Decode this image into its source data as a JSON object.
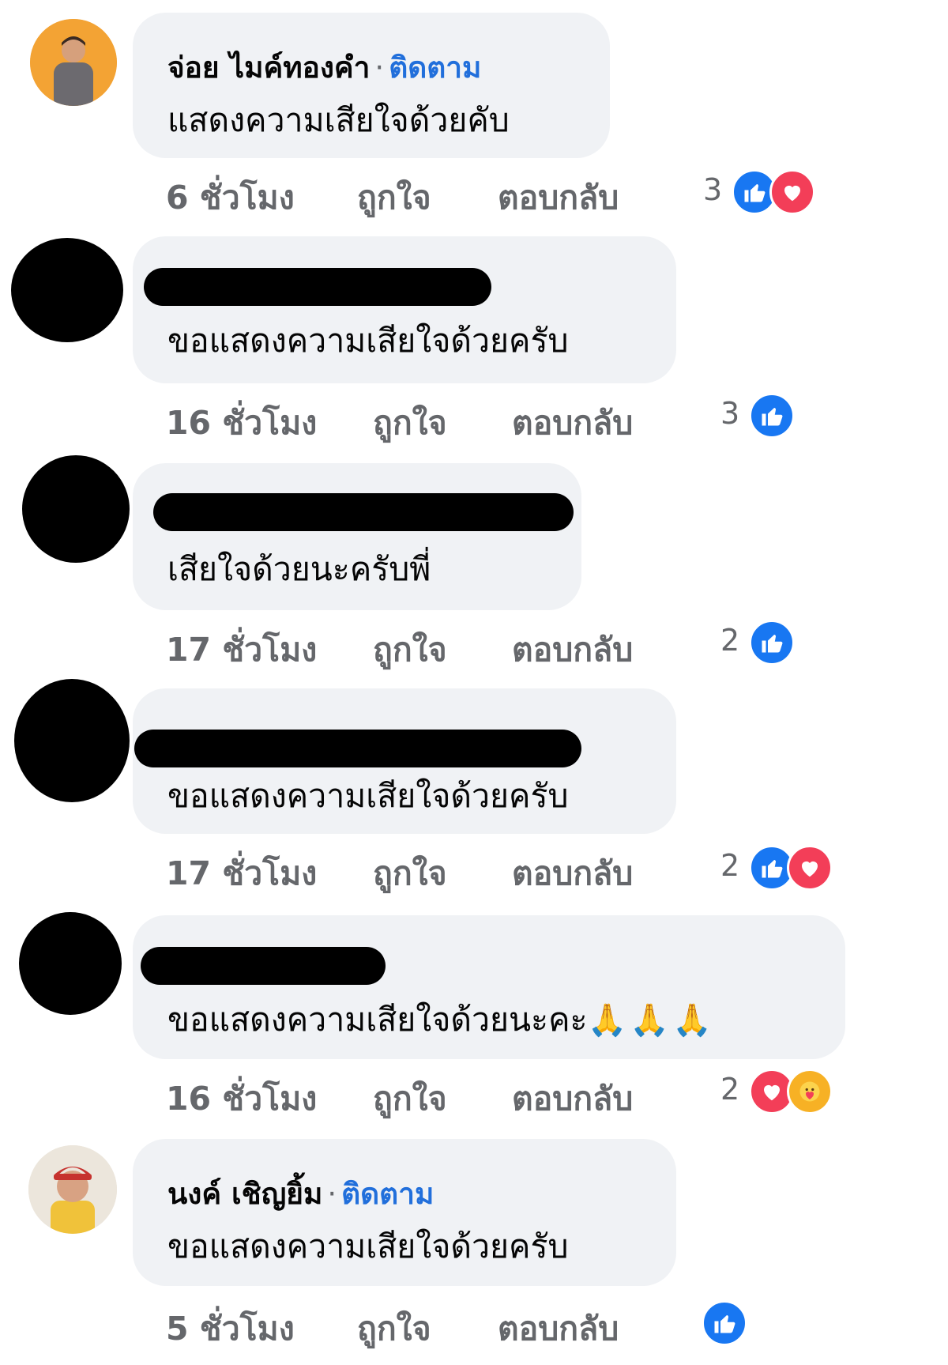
{
  "actions": {
    "like": "ถูกใจ",
    "reply": "ตอบกลับ"
  },
  "follow_label": "ติดตาม",
  "comments": [
    {
      "name": "จ่อย ไมค์ทองคำ",
      "text": "แสดงความเสียใจด้วยคับ",
      "time": "6 ชั่วโมง",
      "reaction_count": "3",
      "reactions": [
        "like-icon",
        "love-icon"
      ]
    },
    {
      "name": "",
      "text": "ขอแสดงความเสียใจด้วยครับ",
      "time": "16 ชั่วโมง",
      "reaction_count": "3",
      "reactions": [
        "like-icon"
      ]
    },
    {
      "name": "",
      "text": "เสียใจด้วยนะครับพี่",
      "time": "17 ชั่วโมง",
      "reaction_count": "2",
      "reactions": [
        "like-icon"
      ]
    },
    {
      "name": "",
      "text": "ขอแสดงความเสียใจด้วยครับ",
      "time": "17 ชั่วโมง",
      "reaction_count": "2",
      "reactions": [
        "like-icon",
        "love-icon"
      ]
    },
    {
      "name": "",
      "text": "ขอแสดงความเสียใจด้วยนะคะ",
      "emoji": "🙏🙏🙏",
      "time": "16 ชั่วโมง",
      "reaction_count": "2",
      "reactions": [
        "love-icon",
        "care-icon"
      ]
    },
    {
      "name": "นงค์ เชิญยิ้ม",
      "text": "ขอแสดงความเสียใจด้วยครับ",
      "time": "5 ชั่วโมง",
      "reaction_count": "",
      "reactions": [
        "like-icon"
      ]
    }
  ],
  "colors": {
    "bubble": "#f0f2f5",
    "link": "#216fdb",
    "meta": "#65676b",
    "like": "#1877f2",
    "love": "#f33e58",
    "care": "#f7b125"
  }
}
